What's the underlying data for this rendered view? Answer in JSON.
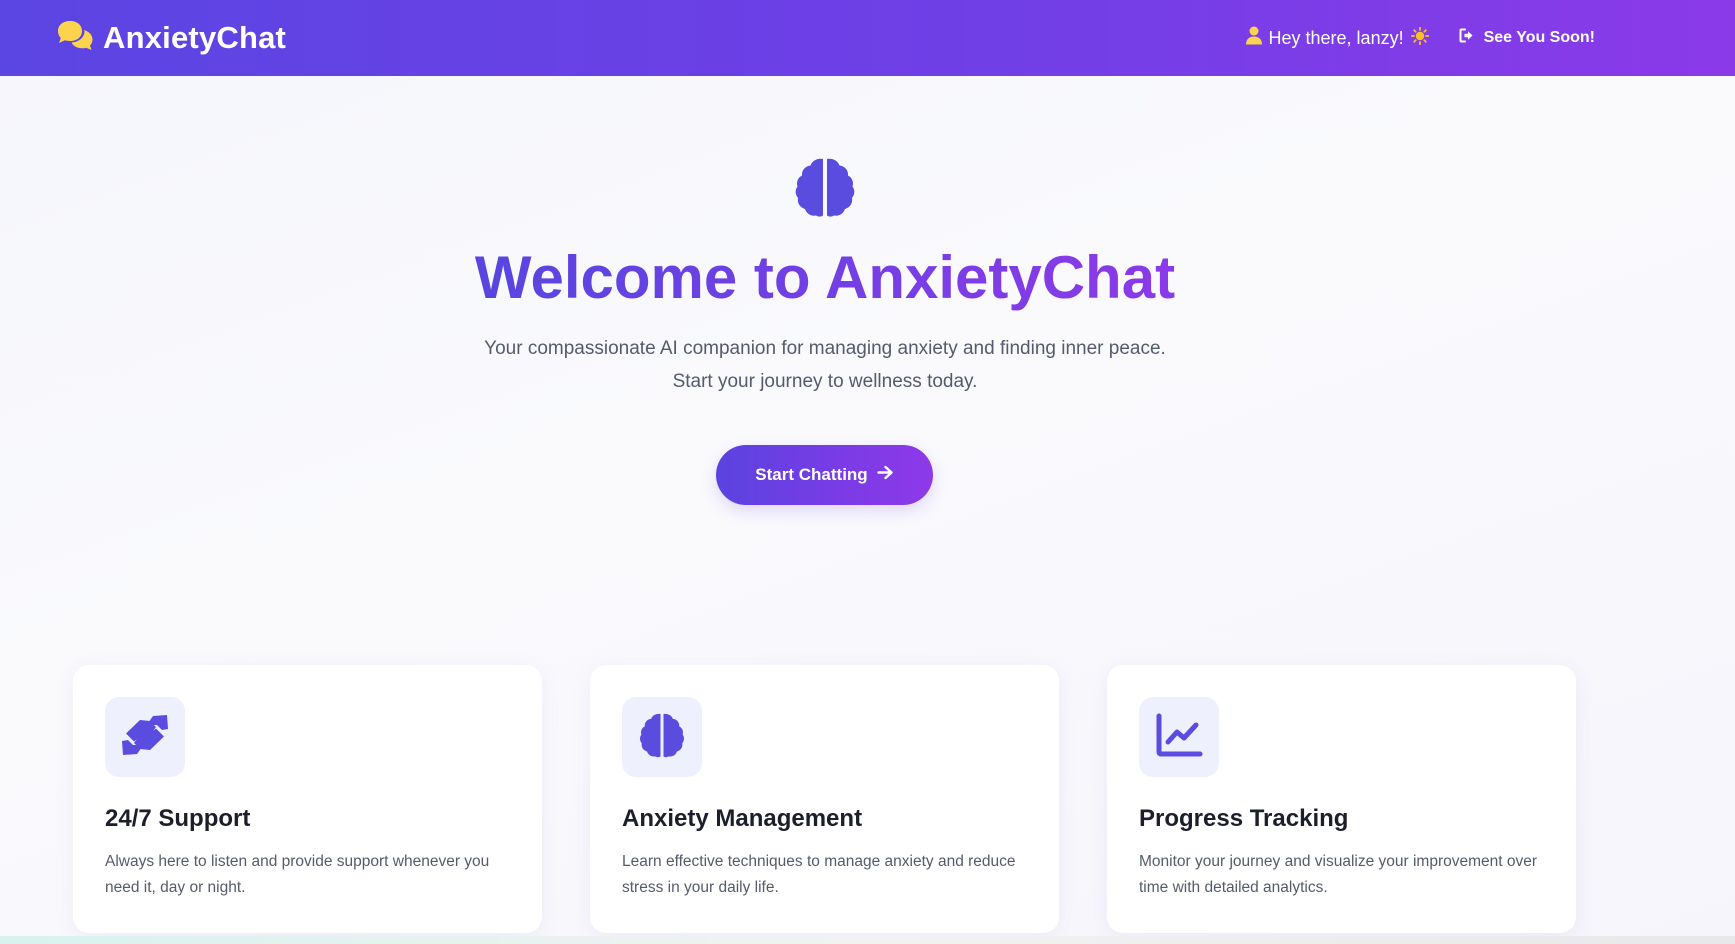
{
  "navbar": {
    "brand_name": "AnxietyChat",
    "brand_icon": "comments-icon",
    "greeting": "Hey there, lanzy!",
    "greeting_emoji": "☀️",
    "logout_label": "See You Soon!",
    "colors": {
      "gradient_start": "#5b45e3",
      "gradient_end": "#8b3ae8",
      "brand_icon": "#fcd34d"
    }
  },
  "hero": {
    "icon": "brain-icon",
    "title": "Welcome to AnxietyChat",
    "subtitle": "Your compassionate AI companion for managing anxiety and finding inner peace. Start your journey to wellness today.",
    "cta_label": "Start Chatting",
    "cta_icon": "arrow-right-icon",
    "accent": "#5b4ce0"
  },
  "features": [
    {
      "icon": "handshake-icon",
      "title": "24/7 Support",
      "description": "Always here to listen and provide support whenever you need it, day or night."
    },
    {
      "icon": "brain-icon",
      "title": "Anxiety Management",
      "description": "Learn effective techniques to manage anxiety and reduce stress in your daily life."
    },
    {
      "icon": "chart-line-icon",
      "title": "Progress Tracking",
      "description": "Monitor your journey and visualize your improvement over time with detailed analytics."
    }
  ]
}
